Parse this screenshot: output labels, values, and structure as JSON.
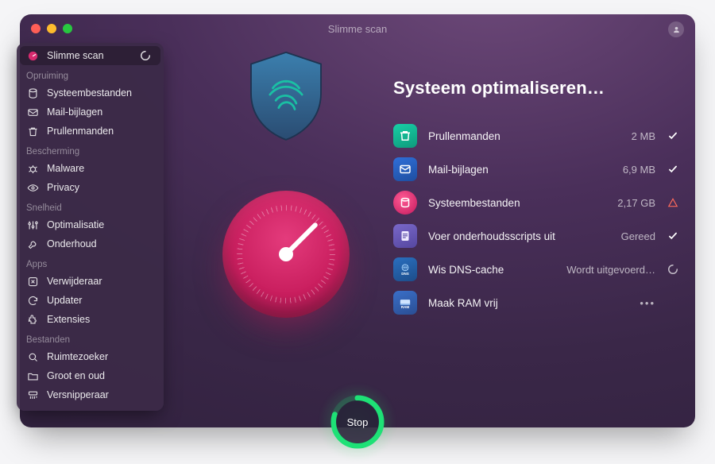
{
  "window": {
    "title": "Slimme scan"
  },
  "sidebar": {
    "smart_scan": "Slimme scan",
    "sections": {
      "cleanup": {
        "label": "Opruiming",
        "items": [
          "Systeembestanden",
          "Mail-bijlagen",
          "Prullenmanden"
        ]
      },
      "protection": {
        "label": "Bescherming",
        "items": [
          "Malware",
          "Privacy"
        ]
      },
      "speed": {
        "label": "Snelheid",
        "items": [
          "Optimalisatie",
          "Onderhoud"
        ]
      },
      "apps": {
        "label": "Apps",
        "items": [
          "Verwijderaar",
          "Updater",
          "Extensies"
        ]
      },
      "files": {
        "label": "Bestanden",
        "items": [
          "Ruimtezoeker",
          "Groot en oud",
          "Versnipperaar"
        ]
      }
    }
  },
  "main": {
    "heading": "Systeem optimaliseren…"
  },
  "rows": {
    "trash": {
      "label": "Prullenmanden",
      "value": "2 MB",
      "status": "done"
    },
    "mail": {
      "label": "Mail-bijlagen",
      "value": "6,9 MB",
      "status": "done"
    },
    "system": {
      "label": "Systeembestanden",
      "value": "2,17 GB",
      "status": "warn"
    },
    "maintenance": {
      "label": "Voer onderhoudsscripts uit",
      "value": "Gereed",
      "status": "done"
    },
    "dns": {
      "label": "Wis DNS-cache",
      "value": "Wordt uitgevoerd…",
      "status": "running"
    },
    "ram": {
      "label": "Maak RAM vrij",
      "value": "•••",
      "status": "pending"
    }
  },
  "stop": {
    "label": "Stop"
  },
  "icon_labels": {
    "dns": "DNS",
    "ram": "RAM"
  },
  "colors": {
    "accent_pink": "#d82a6e",
    "accent_green": "#1ee176",
    "accent_teal": "#12b6a0",
    "warn": "#ff6a5a"
  }
}
